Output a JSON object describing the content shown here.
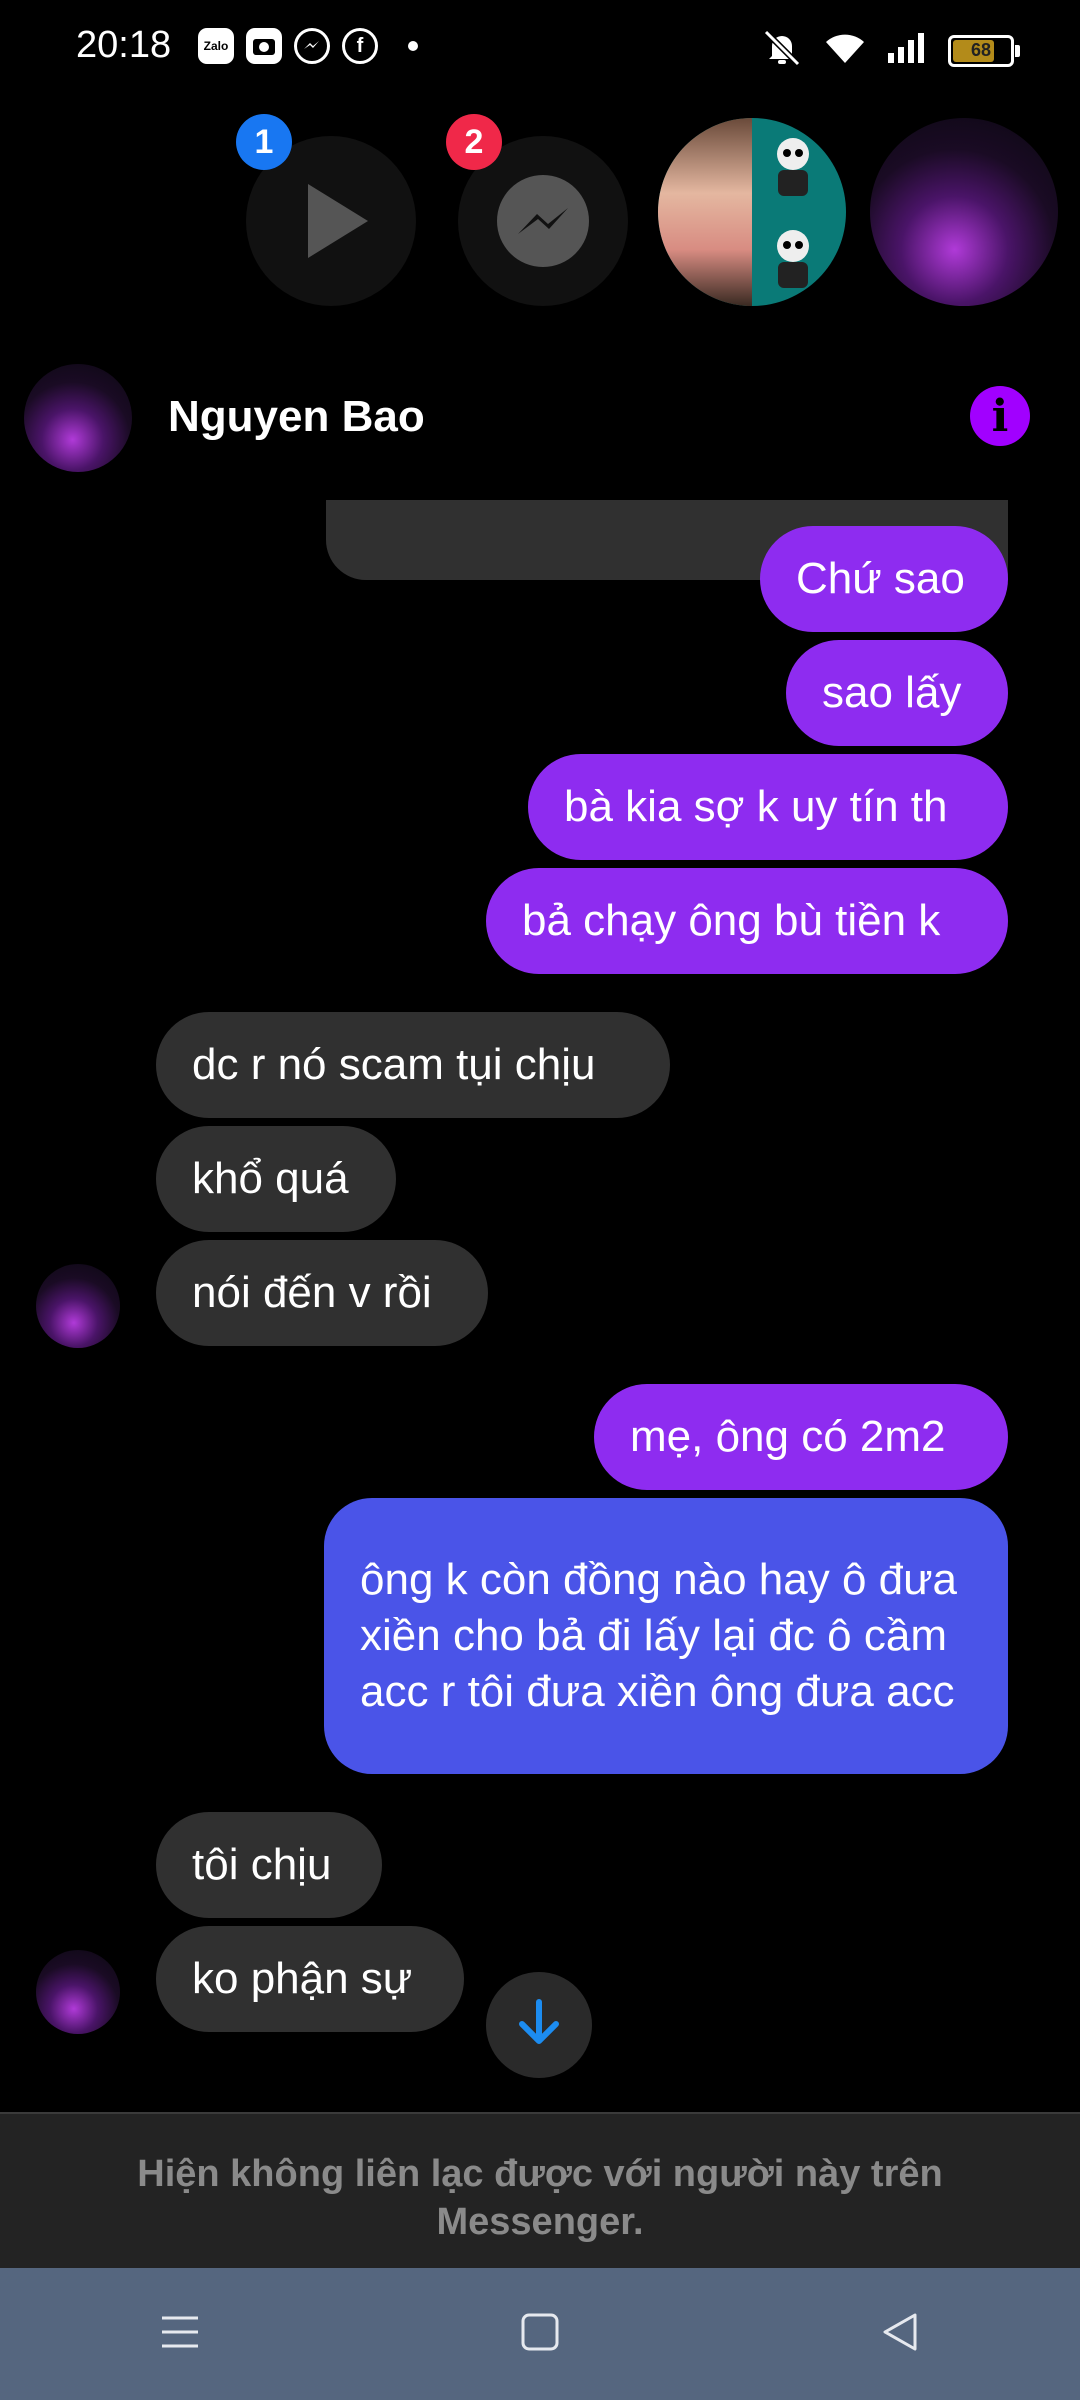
{
  "status_bar": {
    "time": "20:18",
    "battery": "68",
    "apps": [
      "Zalo",
      "camera-app",
      "messenger",
      "facebook"
    ]
  },
  "chat_heads": {
    "badge_1": "1",
    "badge_2": "2"
  },
  "header": {
    "name": "Nguyen Bao"
  },
  "messages": [
    {
      "side": "out",
      "text": "Chứ sao"
    },
    {
      "side": "out",
      "text": "sao lấy"
    },
    {
      "side": "out",
      "text": "bà kia sợ k uy tín th"
    },
    {
      "side": "out",
      "text": "bả chạy ông bù tiền k"
    },
    {
      "side": "in",
      "text": "dc r nó scam tụi chịu"
    },
    {
      "side": "in",
      "text": "khổ quá"
    },
    {
      "side": "in",
      "text": "nói đến v rồi"
    },
    {
      "side": "out",
      "text": "mẹ, ông có 2m2"
    },
    {
      "side": "out",
      "text": "ông k còn đồng nào hay ô đưa xiền cho bả đi lấy lại đc ô cầm acc r tôi đưa xiền ông đưa acc"
    },
    {
      "side": "in",
      "text": "tôi chịu"
    },
    {
      "side": "in",
      "text": "ko phận sự"
    }
  ],
  "footer": {
    "notice": "Hiện không liên lạc được với người này trên Messenger."
  },
  "colors": {
    "outgoing_purple": "#8e2cf0",
    "outgoing_blue": "#4a54e8",
    "incoming": "#303030",
    "info": "#a100ff"
  }
}
